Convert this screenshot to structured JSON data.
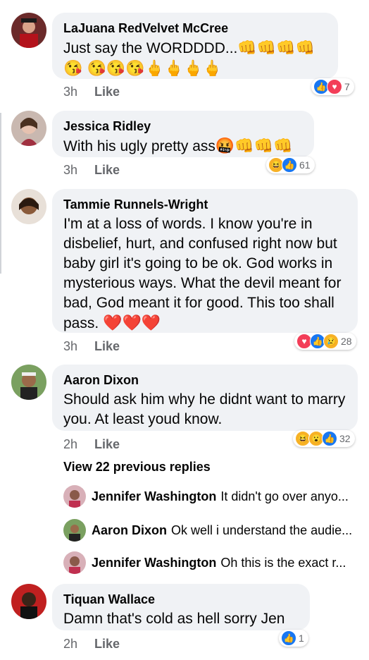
{
  "comments": [
    {
      "name": "LaJuana RedVelvet McCree",
      "text": "Just say the WORDDDD...",
      "emoji_line": "👊👊👊👊😘 😘😘😘🖕🖕🖕🖕",
      "time": "3h",
      "like": "Like",
      "reactions_count": "7",
      "reaction_icons": [
        "like-icon",
        "love-icon"
      ]
    },
    {
      "name": "Jessica Ridley",
      "text": "With his ugly pretty ass",
      "emoji_line": "🤬👊👊👊",
      "time": "3h",
      "like": "Like",
      "reactions_count": "61",
      "reaction_icons": [
        "haha-icon",
        "like-icon"
      ]
    },
    {
      "name": "Tammie Runnels-Wright",
      "text": "I'm at a loss of words. I know you're in disbelief, hurt, and confused right now but baby girl it's going to be ok. God works in mysterious ways. What the devil meant for bad, God meant it for good. This too shall pass.",
      "emoji_line": "❤️❤️❤️",
      "time": "3h",
      "like": "Like",
      "reactions_count": "28",
      "reaction_icons": [
        "love-icon",
        "like-icon",
        "sad-icon"
      ]
    },
    {
      "name": "Aaron Dixon",
      "text": "Should ask him why he didnt want to marry you. At least youd know.",
      "time": "2h",
      "like": "Like",
      "reactions_count": "32",
      "reaction_icons": [
        "haha-icon",
        "wow-icon",
        "like-icon"
      ]
    },
    {
      "name": "Tiquan Wallace",
      "text": "Damn that's cold as hell sorry Jen",
      "time": "2h",
      "like": "Like",
      "reactions_count": "1",
      "reaction_icons": [
        "like-icon"
      ]
    }
  ],
  "view_more": "View 22 previous replies",
  "replies": [
    {
      "name": "Jennifer Washington",
      "text": "It didn't go over anyo..."
    },
    {
      "name": "Aaron Dixon",
      "text": "Ok well i understand the audie..."
    },
    {
      "name": "Jennifer Washington",
      "text": "Oh this is the exact r..."
    }
  ],
  "colors": {
    "bubble": "#f0f2f5",
    "like": "#1877f2",
    "love": "#f33e58",
    "meta": "#65676b"
  }
}
